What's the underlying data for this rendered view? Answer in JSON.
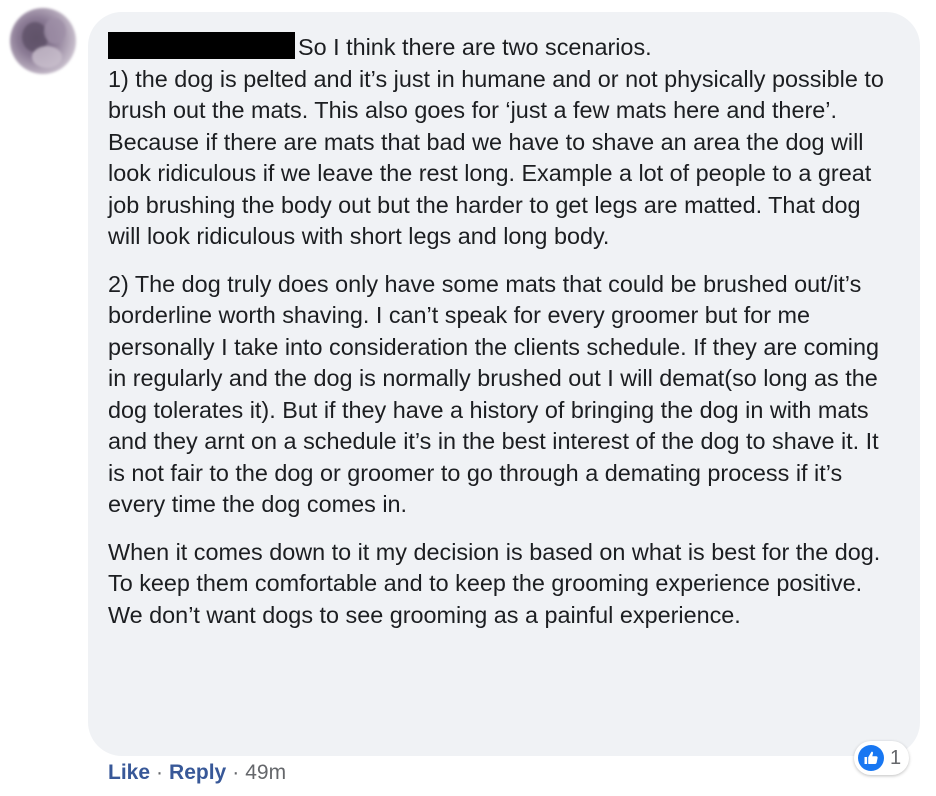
{
  "comment": {
    "opening": "So I think there are two scenarios.",
    "paragraphs": [
      "1) the dog is pelted and it’s just in humane and or not physically possible to brush out the mats. This also goes for ‘just a few mats here and there’. Because if there are mats that bad we have to shave an area the dog will look ridiculous if we leave the rest long. Example a lot of people to a great job brushing the body out but the harder to get legs are matted. That dog will look ridiculous with short legs and long body.",
      "2) The dog truly does only have some mats that could be brushed out/it’s borderline worth shaving. I can’t speak for every groomer but for me personally I take into consideration the clients schedule. If they are coming in regularly and the dog is normally brushed out I will demat(so long as the dog tolerates it). But if they have a history of bringing the dog in with mats and they arnt on a schedule it’s in the best interest of the dog to shave it. It is not fair to the dog or groomer to go through a demating process if it’s every time the dog comes in.",
      "When it comes down to it my decision is based on what is best for the dog. To keep them comfortable and to keep the grooming experience positive. We don’t want dogs to see grooming as a painful experience."
    ]
  },
  "reactions": {
    "icon": "thumbs-up-icon",
    "count": "1",
    "color": "#1877f2"
  },
  "actions": {
    "like_label": "Like",
    "separator": "·",
    "reply_label": "Reply",
    "timestamp": "49m",
    "link_color": "#385898"
  }
}
